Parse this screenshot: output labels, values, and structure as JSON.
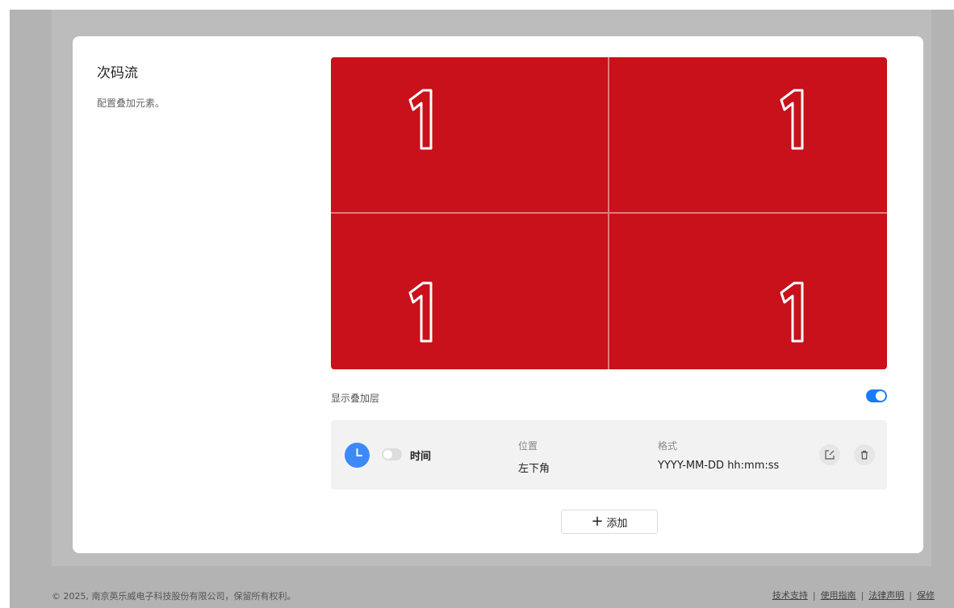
{
  "section": {
    "title": "次码流",
    "description": "配置叠加元素。"
  },
  "preview": {
    "background_color": "#c8111a",
    "tile_number": "1"
  },
  "overlay_toggle": {
    "label": "显示叠加层",
    "enabled": true
  },
  "overlay_items": [
    {
      "icon": "clock-icon",
      "enabled": false,
      "name": "时间",
      "position_label": "位置",
      "position_value": "左下角",
      "format_label": "格式",
      "format_value": "YYYY-MM-DD hh:mm:ss"
    }
  ],
  "add_button": {
    "label": "添加"
  },
  "footer": {
    "copyright": "© 2025, 南京英乐威电子科技股份有限公司，保留所有权利。",
    "links": [
      "技术支持",
      "使用指南",
      "法律声明",
      "保修"
    ]
  },
  "colors": {
    "accent": "#1a7cf5",
    "clock_icon": "#3c8af7"
  }
}
